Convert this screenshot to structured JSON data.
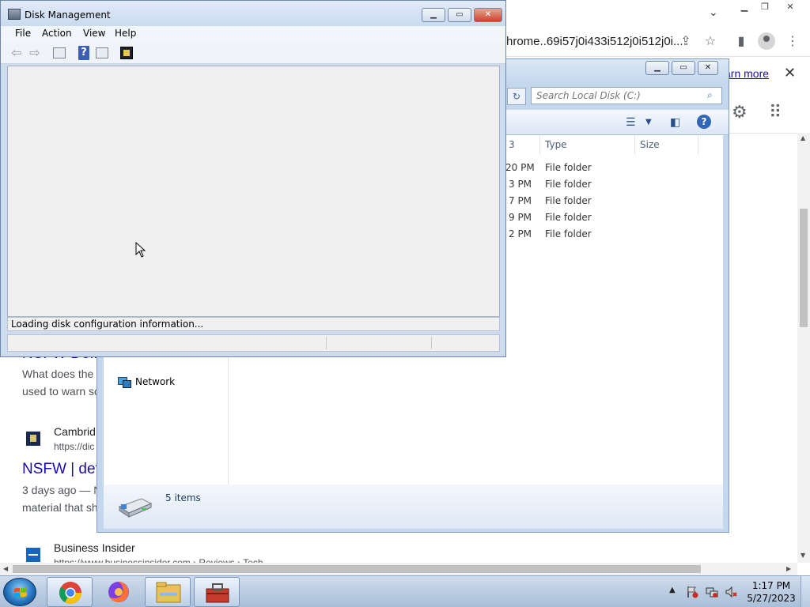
{
  "chrome": {
    "omnibox_text": "hrome..69i57j0i433i512j0i512j0i...",
    "learn_more": "arn more",
    "results": [
      {
        "title": "NSFW Defi",
        "snippet_lines": [
          "What does the",
          "used to warn so"
        ]
      },
      {
        "site": "Cambrid",
        "url": "https://dic",
        "title": "NSFW | def",
        "date_prefix": "3 days ago — N",
        "snippet": "material that sh"
      },
      {
        "site": "Business Insider",
        "url": "https://www.businessinsider.com › Reviews › Tech"
      }
    ]
  },
  "explorer": {
    "search_placeholder": "Search Local Disk (C:)",
    "columns": {
      "date_partial": "3",
      "type": "Type",
      "size": "Size"
    },
    "rows": [
      {
        "date_partial": "20 PM",
        "type": "File folder"
      },
      {
        "date_partial": "3 PM",
        "type": "File folder"
      },
      {
        "date_partial": "7 PM",
        "type": "File folder"
      },
      {
        "date_partial": "9 PM",
        "type": "File folder"
      },
      {
        "date_partial": "2 PM",
        "type": "File folder"
      }
    ],
    "nav_network": "Network",
    "item_count": "5 items"
  },
  "diskmgmt": {
    "title": "Disk Management",
    "menu": [
      "File",
      "Action",
      "View",
      "Help"
    ],
    "status": "Loading disk configuration information..."
  },
  "taskbar": {
    "time": "1:17 PM",
    "date": "5/27/2023"
  },
  "colors": {
    "accent_link": "#1a0dab",
    "window_frame": "#c4d7ec",
    "close_button": "#c9452e"
  }
}
